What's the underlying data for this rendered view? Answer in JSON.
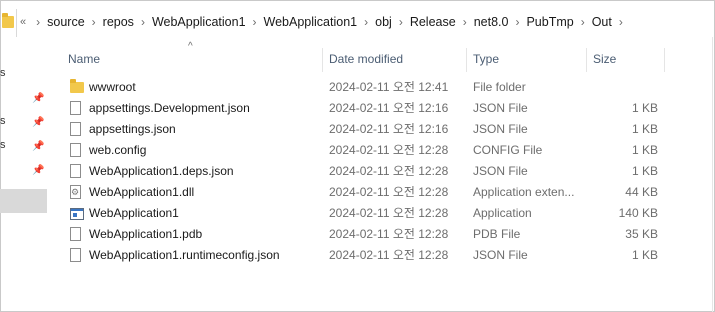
{
  "breadcrumb": {
    "overflow": "«",
    "items": [
      "source",
      "repos",
      "WebApplication1",
      "WebApplication1",
      "obj",
      "Release",
      "net8.0",
      "PubTmp",
      "Out"
    ]
  },
  "nav": {
    "fragments": [
      "s",
      "s",
      "s"
    ]
  },
  "columns": {
    "name": "Name",
    "date": "Date modified",
    "type": "Type",
    "size": "Size"
  },
  "files": [
    {
      "name": "wwwroot",
      "date": "2024-02-11 오전 12:41",
      "type": "File folder",
      "size": "",
      "icon": "folder-icon"
    },
    {
      "name": "appsettings.Development.json",
      "date": "2024-02-11 오전 12:16",
      "type": "JSON File",
      "size": "1 KB",
      "icon": "file-icon"
    },
    {
      "name": "appsettings.json",
      "date": "2024-02-11 오전 12:16",
      "type": "JSON File",
      "size": "1 KB",
      "icon": "file-icon"
    },
    {
      "name": "web.config",
      "date": "2024-02-11 오전 12:28",
      "type": "CONFIG File",
      "size": "1 KB",
      "icon": "file-icon"
    },
    {
      "name": "WebApplication1.deps.json",
      "date": "2024-02-11 오전 12:28",
      "type": "JSON File",
      "size": "1 KB",
      "icon": "file-icon"
    },
    {
      "name": "WebApplication1.dll",
      "date": "2024-02-11 오전 12:28",
      "type": "Application exten...",
      "size": "44 KB",
      "icon": "gear-file-icon"
    },
    {
      "name": "WebApplication1",
      "date": "2024-02-11 오전 12:28",
      "type": "Application",
      "size": "140 KB",
      "icon": "app-icon"
    },
    {
      "name": "WebApplication1.pdb",
      "date": "2024-02-11 오전 12:28",
      "type": "PDB File",
      "size": "35 KB",
      "icon": "file-icon"
    },
    {
      "name": "WebApplication1.runtimeconfig.json",
      "date": "2024-02-11 오전 12:28",
      "type": "JSON File",
      "size": "1 KB",
      "icon": "file-icon"
    }
  ]
}
